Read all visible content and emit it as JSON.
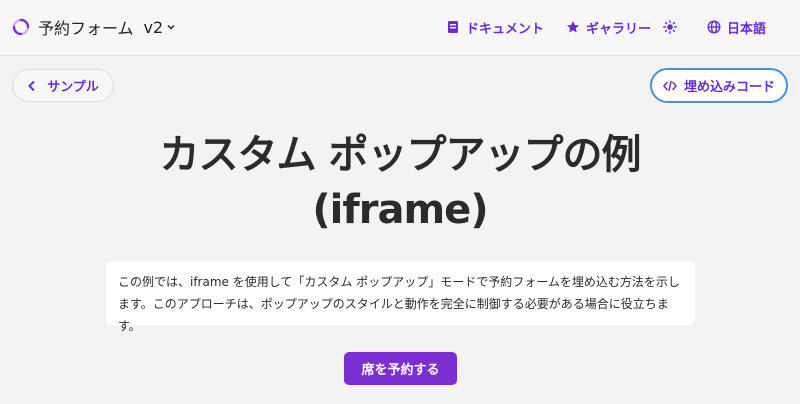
{
  "header": {
    "brand_icon": "loader-icon",
    "brand_name": "予約フォーム",
    "version": "v2",
    "nav": {
      "docs": {
        "label": "ドキュメント",
        "icon": "book-icon"
      },
      "gallery": {
        "label": "ギャラリー",
        "icon": "star-icon"
      },
      "theme": {
        "icon": "sun-icon"
      },
      "language": {
        "label": "日本語",
        "icon": "globe-icon"
      }
    }
  },
  "toolbar": {
    "back_label": "サンプル",
    "embed_label": "埋め込みコード"
  },
  "main": {
    "title_line1": "カスタム ポップアップの例",
    "title_line2": "(iframe)",
    "description": "この例では、iframe を使用して「カスタム ポップアップ」モードで予約フォームを埋め込む方法を示します。このアプローチは、ポップアップのスタイルと動作を完全に制御する必要がある場合に役立ちます。",
    "reserve_label": "席を予約する"
  },
  "colors": {
    "accent": "#7b2fd1",
    "link": "#6b2bd6",
    "embed_border": "#4a90d9",
    "background": "#f3f3f4"
  }
}
